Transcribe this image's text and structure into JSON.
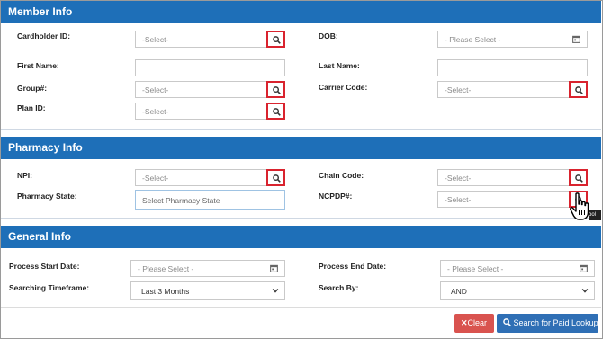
{
  "member": {
    "title": "Member Info",
    "cardholder_label": "Cardholder ID:",
    "cardholder_placeholder": "-Select-",
    "dob_label": "DOB:",
    "dob_placeholder": "- Please Select -",
    "first_name_label": "First Name:",
    "last_name_label": "Last Name:",
    "group_label": "Group#:",
    "group_placeholder": "-Select-",
    "carrier_label": "Carrier Code:",
    "carrier_placeholder": "-Select-",
    "plan_label": "Plan ID:",
    "plan_placeholder": "-Select-"
  },
  "pharmacy": {
    "title": "Pharmacy Info",
    "npi_label": "NPI:",
    "npi_placeholder": "-Select-",
    "chain_label": "Chain Code:",
    "chain_placeholder": "-Select-",
    "state_label": "Pharmacy State:",
    "state_placeholder": "Select Pharmacy State",
    "ncpdp_label": "NCPDP#:",
    "ncpdp_placeholder": "-Select-",
    "tooltip_fragment": "ool"
  },
  "general": {
    "title": "General Info",
    "start_label": "Process Start Date:",
    "start_placeholder": "- Please Select -",
    "end_label": "Process End Date:",
    "end_placeholder": "- Please Select -",
    "timeframe_label": "Searching Timeframe:",
    "timeframe_value": "Last 3 Months",
    "searchby_label": "Search By:",
    "searchby_value": "AND"
  },
  "actions": {
    "clear_label": "Clear",
    "search_label": "Search for Paid Lookup"
  },
  "colors": {
    "header": "#1e6fb8",
    "highlight": "#d9232e",
    "clear": "#d9534f",
    "search": "#2f6fb5"
  }
}
